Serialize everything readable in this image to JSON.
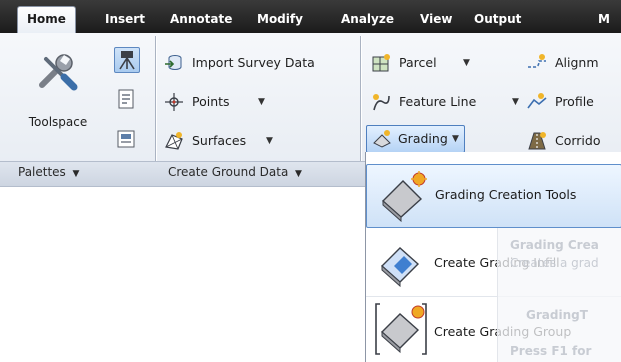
{
  "ribbon": {
    "tabs": [
      {
        "label": "Home",
        "active": true
      },
      {
        "label": "Insert"
      },
      {
        "label": "Annotate"
      },
      {
        "label": "Modify"
      },
      {
        "label": "Analyze"
      },
      {
        "label": "View"
      },
      {
        "label": "Output"
      },
      {
        "label": "M"
      }
    ],
    "toolspace_label": "Toolspace",
    "palettes_panel_title": "Palettes",
    "ground_panel_title": "Create Ground Data",
    "import_survey": "Import Survey Data",
    "points": "Points",
    "surfaces": "Surfaces",
    "parcel": "Parcel",
    "feature_line": "Feature Line",
    "grading": "Grading",
    "alignment": "Alignm",
    "profile": "Profile",
    "corridor": "Corrido"
  },
  "dropdown": {
    "items": [
      {
        "label": "Grading Creation Tools"
      },
      {
        "label": "Create Grading Infill"
      },
      {
        "label": "Create Grading Group"
      }
    ]
  },
  "tooltip": {
    "title": "Grading Crea",
    "desc": "Creates a grad",
    "command": "GradingT",
    "help": "Press F1 for"
  },
  "colors": {
    "accent": "#4f7fbf",
    "tabbar": "#2a2a2a",
    "ribbon": "#eef2f7"
  }
}
